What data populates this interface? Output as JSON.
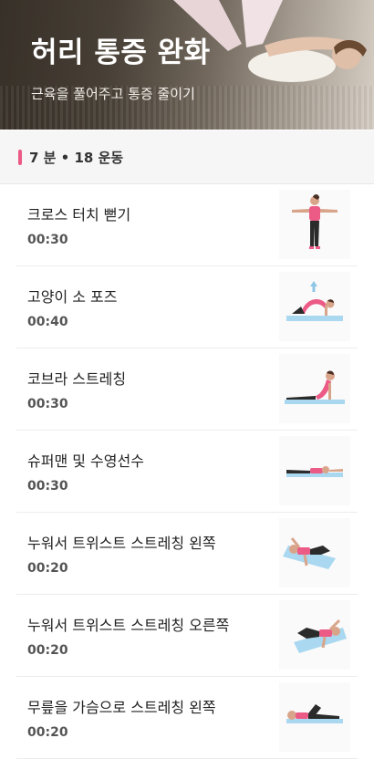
{
  "header": {
    "title": "허리 통증 완화",
    "subtitle": "근육을 풀어주고 통증 줄이기"
  },
  "summary": {
    "text": "7 분 • 18 운동"
  },
  "exercises": [
    {
      "name": "크로스 터치 뻗기",
      "duration": "00:30",
      "icon": "standing-arms-out-figure"
    },
    {
      "name": "고양이 소 포즈",
      "duration": "00:40",
      "icon": "cat-cow-pose-figure"
    },
    {
      "name": "코브라 스트레칭",
      "duration": "00:30",
      "icon": "cobra-stretch-figure"
    },
    {
      "name": "슈퍼맨 및 수영선수",
      "duration": "00:30",
      "icon": "superman-figure"
    },
    {
      "name": "누워서 트위스트 스트레칭 왼쪽",
      "duration": "00:20",
      "icon": "lying-twist-left-figure"
    },
    {
      "name": "누워서 트위스트 스트레칭 오른쪽",
      "duration": "00:20",
      "icon": "lying-twist-right-figure"
    },
    {
      "name": "무릎을 가슴으로 스트레칭 왼쪽",
      "duration": "00:20",
      "icon": "knee-to-chest-figure"
    }
  ],
  "colors": {
    "accent": "#ec5a86",
    "mat": "#a9d8f0",
    "pants": "#2b2b2b"
  }
}
